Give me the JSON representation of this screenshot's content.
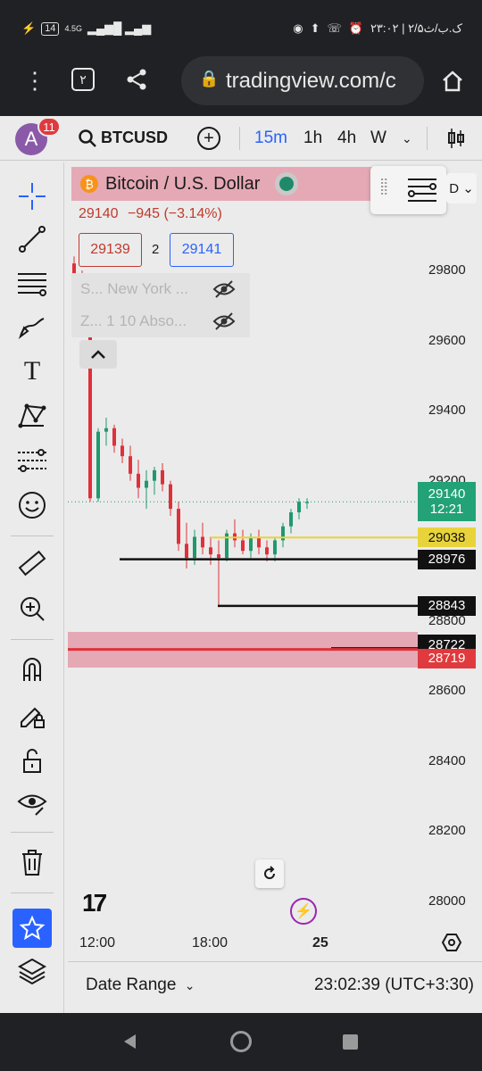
{
  "status": {
    "battery": "14",
    "net": "4.5G",
    "right_text": "۲۳:۰۲ | ۲/۵ک.ب/ث"
  },
  "browser": {
    "url": "tradingview.com/c",
    "tab_count": "۲"
  },
  "toolbar": {
    "notification_count": "11",
    "avatar_letter": "A",
    "symbol": "BTCUSD",
    "intervals": [
      "15m",
      "1h",
      "4h",
      "W"
    ],
    "active_interval": "15m"
  },
  "legend": {
    "title": "Bitcoin / U.S. Dollar",
    "last": "29140",
    "change": "−945 (−3.14%)",
    "bid": "29139",
    "spread": "2",
    "ask": "29141",
    "indicator1": "S... New York ...",
    "indicator2": "Z... 1 10 Abso..."
  },
  "chart_data": {
    "type": "candlestick",
    "y_ticks": [
      "29800",
      "29600",
      "29400",
      "29200",
      "28800",
      "28600",
      "28400",
      "28200",
      "28000"
    ],
    "x_ticks": [
      "12:00",
      "18:00",
      "25"
    ],
    "price_labels": [
      {
        "value": "29140",
        "sub": "12:21",
        "color": "#22a276"
      },
      {
        "value": "29038",
        "color": "#e8d43a"
      },
      {
        "value": "28976",
        "color": "#111111"
      },
      {
        "value": "28843",
        "color": "#111111"
      },
      {
        "value": "28722",
        "color": "#111111"
      },
      {
        "value": "28719",
        "color": "#e03a3e"
      }
    ],
    "ohlc": [
      [
        29820,
        29840,
        29760,
        29780
      ],
      [
        29780,
        29800,
        29700,
        29720
      ],
      [
        29720,
        29740,
        29140,
        29150
      ],
      [
        29150,
        29350,
        29140,
        29340
      ],
      [
        29340,
        29380,
        29300,
        29350
      ],
      [
        29350,
        29360,
        29280,
        29300
      ],
      [
        29300,
        29320,
        29250,
        29270
      ],
      [
        29270,
        29300,
        29200,
        29220
      ],
      [
        29220,
        29260,
        29150,
        29180
      ],
      [
        29180,
        29230,
        29120,
        29200
      ],
      [
        29200,
        29240,
        29160,
        29230
      ],
      [
        29230,
        29250,
        29170,
        29190
      ],
      [
        29190,
        29200,
        29100,
        29120
      ],
      [
        29120,
        29140,
        29000,
        29020
      ],
      [
        29020,
        29080,
        28950,
        28980
      ],
      [
        28980,
        29060,
        28960,
        29040
      ],
      [
        29040,
        29080,
        28990,
        29010
      ],
      [
        29010,
        29040,
        28960,
        28990
      ],
      [
        28990,
        29030,
        28840,
        28980
      ],
      [
        28980,
        29060,
        28970,
        29050
      ],
      [
        29050,
        29090,
        29010,
        29030
      ],
      [
        29030,
        29060,
        28990,
        29000
      ],
      [
        29000,
        29050,
        28980,
        29040
      ],
      [
        29040,
        29060,
        28990,
        29010
      ],
      [
        29010,
        29030,
        28970,
        28990
      ],
      [
        28990,
        29040,
        28970,
        29030
      ],
      [
        29030,
        29080,
        29010,
        29070
      ],
      [
        29070,
        29120,
        29050,
        29110
      ],
      [
        29110,
        29150,
        29090,
        29140
      ],
      [
        29140,
        29150,
        29120,
        29140
      ]
    ]
  },
  "bottom": {
    "date_range": "Date Range",
    "clock": "23:02:39 (UTC+3:30)"
  }
}
